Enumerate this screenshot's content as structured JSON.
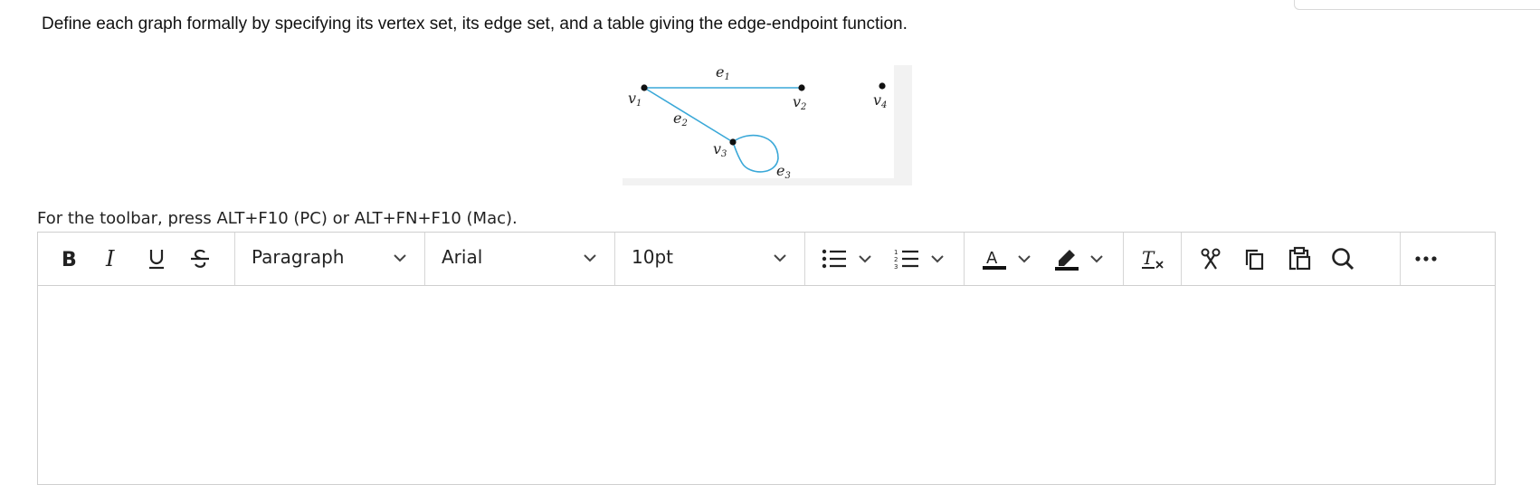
{
  "question": "Define each graph formally by specifying its vertex set, its edge set, and a table giving the edge-endpoint function.",
  "graph": {
    "vertices": [
      "v1",
      "v2",
      "v3",
      "v4"
    ],
    "edges": [
      {
        "name": "e1",
        "endpoints": [
          "v1",
          "v2"
        ]
      },
      {
        "name": "e2",
        "endpoints": [
          "v1",
          "v3"
        ]
      },
      {
        "name": "e3",
        "endpoints": [
          "v3"
        ]
      }
    ],
    "edge_color": "#3aa8d8",
    "vertex_color": "#111111"
  },
  "toolbar_help": "For the toolbar, press ALT+F10 (PC) or ALT+FN+F10 (Mac).",
  "toolbar": {
    "format_buttons": [
      "bold-icon",
      "italic-icon",
      "underline-icon",
      "strikethrough-icon"
    ],
    "block_format": "Paragraph",
    "font_family": "Arial",
    "font_size": "10pt",
    "list_buttons": [
      "bullet-list-icon",
      "numbered-list-icon"
    ],
    "color_buttons": [
      "text-color-icon",
      "highlight-icon"
    ],
    "clear_format": "clear-formatting-icon",
    "clipboard_buttons": [
      "cut-icon",
      "copy-icon",
      "paste-icon",
      "find-icon"
    ],
    "more": "more-icon"
  }
}
